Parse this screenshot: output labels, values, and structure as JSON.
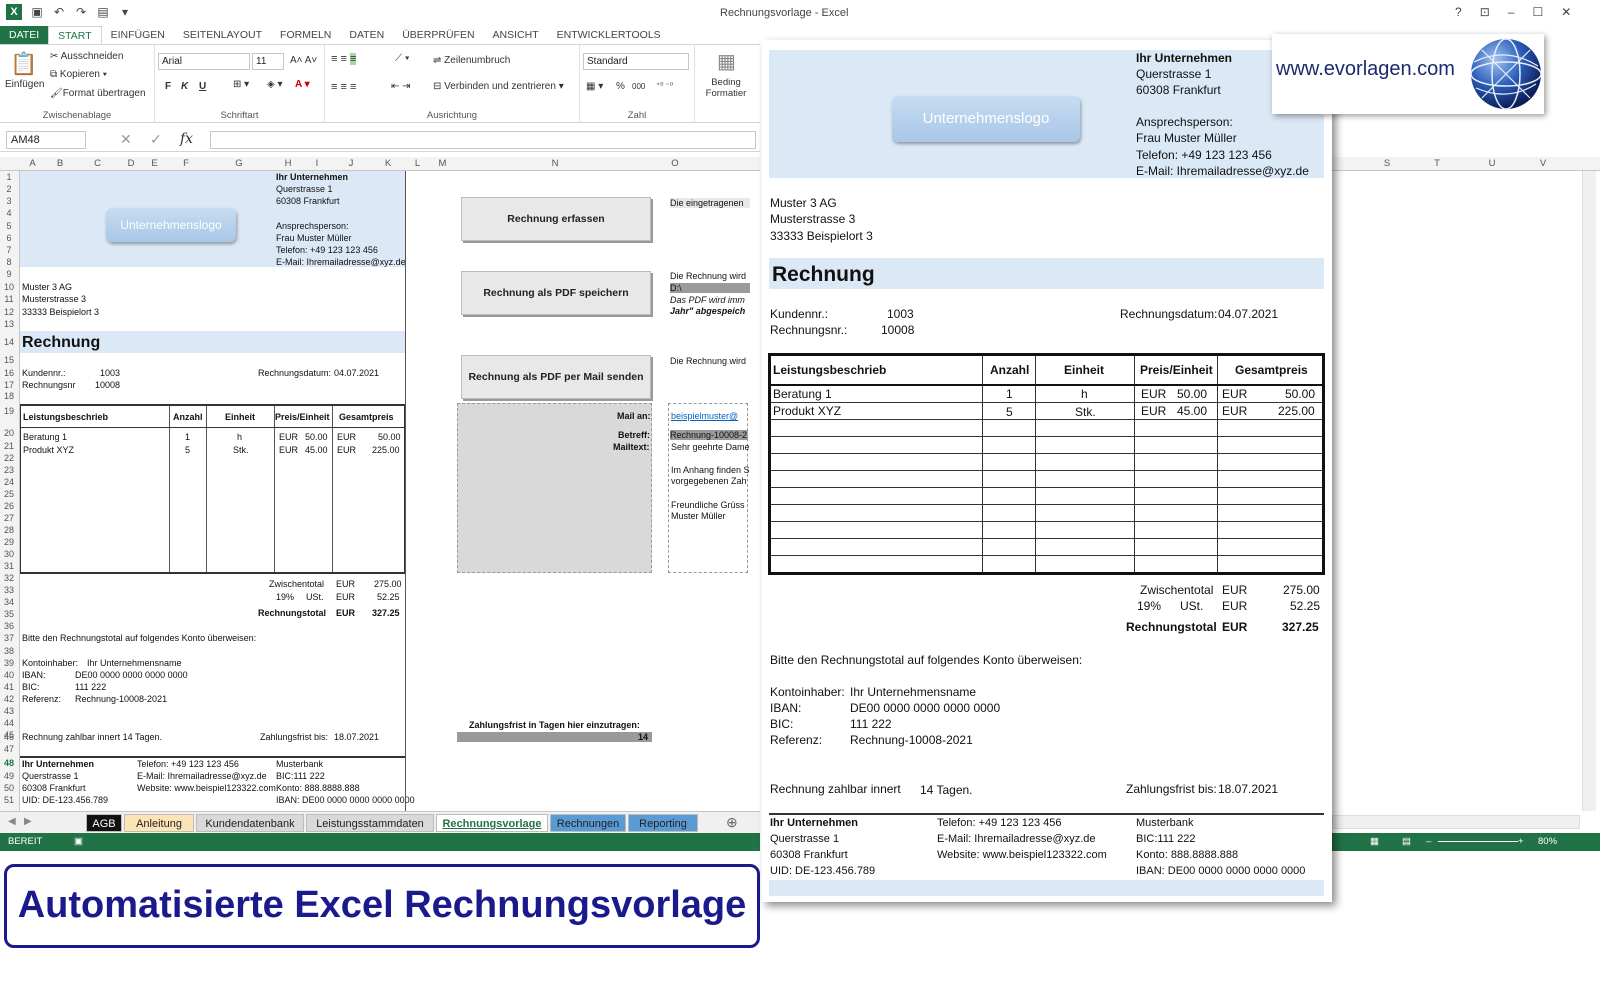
{
  "window": {
    "title": "Rechnungsvorlage - Excel",
    "help": "?"
  },
  "ribbon": {
    "tabs": [
      "DATEI",
      "START",
      "EINFÜGEN",
      "SEITENLAYOUT",
      "FORMELN",
      "DATEN",
      "ÜBERPRÜFEN",
      "ANSICHT",
      "ENTWICKLERTOOLS"
    ],
    "clipboard": {
      "paste": "Einfügen",
      "cut": "Ausschneiden",
      "copy": "Kopieren",
      "format": "Format übertragen",
      "label": "Zwischenablage"
    },
    "font": {
      "name": "Arial",
      "size": "11",
      "bold": "F",
      "italic": "K",
      "underline": "U",
      "label": "Schriftart"
    },
    "alignment": {
      "wrap": "Zeilenumbruch",
      "merge": "Verbinden und zentrieren",
      "label": "Ausrichtung"
    },
    "number": {
      "format": "Standard",
      "percent": "%",
      "thousands": "000",
      "label": "Zahl"
    },
    "styles": {
      "conditional": "Beding Formatier"
    }
  },
  "formula_bar": {
    "name_box": "AM48",
    "fx": "fx"
  },
  "columns": [
    "A",
    "B",
    "C",
    "D",
    "E",
    "F",
    "G",
    "H",
    "I",
    "J",
    "K",
    "L",
    "M",
    "N",
    "O"
  ],
  "right_columns": [
    "S",
    "T",
    "U",
    "V"
  ],
  "rows": [
    "1",
    "2",
    "3",
    "4",
    "5",
    "6",
    "7",
    "8",
    "9",
    "10",
    "11",
    "12",
    "13",
    "14",
    "15",
    "16",
    "17",
    "18",
    "19",
    "20",
    "21",
    "22",
    "23",
    "24",
    "25",
    "26",
    "27",
    "28",
    "29",
    "30",
    "31",
    "32",
    "33",
    "34",
    "35",
    "36",
    "37",
    "38",
    "39",
    "40",
    "41",
    "42",
    "43",
    "44",
    "45",
    "46",
    "47",
    "48",
    "49",
    "50",
    "51"
  ],
  "company": {
    "name": "Ihr Unternehmen",
    "street": "Querstrasse 1",
    "city": "60308 Frankfurt",
    "contact_label": "Ansprechsperson:",
    "contact": "Frau Muster Müller",
    "phone": "Telefon: +49 123 123 456",
    "email": "E-Mail: Ihremailadresse@xyz.de"
  },
  "logo": "Unternehmenslogo",
  "customer": {
    "name": "Muster 3 AG",
    "street": "Musterstrasse 3",
    "city": "33333  Beispielort 3"
  },
  "invoice": {
    "title": "Rechnung",
    "kunde_label": "Kundennr.:",
    "kunde": "1003",
    "nr_label": "Rechnungsnr.:",
    "nr_label_short": "Rechnungsnr",
    "nr": "10008",
    "date_label": "Rechnungsdatum:",
    "date": "04.07.2021"
  },
  "table": {
    "headers": [
      "Leistungsbeschrieb",
      "Anzahl",
      "Einheit",
      "Preis/Einheit",
      "Gesamtpreis"
    ],
    "rows": [
      {
        "desc": "Beratung 1",
        "qty": "1",
        "unit": "h",
        "cur": "EUR",
        "price": "50.00",
        "cur2": "EUR",
        "total": "50.00"
      },
      {
        "desc": "Produkt XYZ",
        "qty": "5",
        "unit": "Stk.",
        "cur": "EUR",
        "price": "45.00",
        "cur2": "EUR",
        "total": "225.00"
      }
    ]
  },
  "totals": {
    "sub_label": "Zwischentotal",
    "cur": "EUR",
    "sub": "275.00",
    "vat_pct": "19%",
    "vat_label": "USt.",
    "vat": "52.25",
    "total_label": "Rechnungstotal",
    "total": "327.25"
  },
  "payment": {
    "intro": "Bitte den Rechnungstotal auf folgendes Konto überweisen:",
    "holder_label": "Kontoinhaber:",
    "holder": "Ihr Unternehmensname",
    "iban_label": "IBAN:",
    "iban": "DE00 0000 0000 0000 0000",
    "bic_label": "BIC:",
    "bic": "111 222",
    "ref_label": "Referenz:",
    "ref": "Rechnung-10008-2021",
    "due_text": "Rechnung zahlbar innert",
    "days": "14",
    "days_suffix": "Tagen.",
    "deadline_label": "Zahlungsfrist bis:",
    "deadline": "18.07.2021"
  },
  "footer": {
    "c1": [
      "Ihr Unternehmen",
      "Querstrasse 1",
      "60308 Frankfurt",
      "UID: DE-123.456.789"
    ],
    "c2": [
      "Telefon: +49 123 123 456",
      "E-Mail: Ihremailadresse@xyz.de",
      "Website: www.beispiel123322.com"
    ],
    "c3": [
      "Musterbank",
      "BIC:111 222",
      "Konto: 888.8888.888",
      "IBAN: DE00 0000 0000 0000 0000"
    ]
  },
  "macros": {
    "btn1": "Rechnung erfassen",
    "btn2": "Rechnung als PDF speichern",
    "btn3": "Rechnung als PDF per Mail senden",
    "note1": "Die eingetragenen",
    "note2": "Die Rechnung wird",
    "path": "D:\\",
    "note3": "Das PDF wird imm",
    "note4": "Jahr\" abgespeich",
    "note5": "Die Rechnung wird",
    "mail_to_label": "Mail an:",
    "mail_to": "beispielmuster@",
    "subject_label": "Betreff:",
    "subject": "Rechnung-10008-2",
    "text_label": "Mailtext:",
    "mail_lines": [
      "Sehr geehrte Dame",
      "",
      "Im Anhang finden S",
      "vorgegebenen Zah",
      "",
      "Freundliche Grüss",
      "Muster Müller"
    ],
    "deadline_entry": "Zahlungsfrist in Tagen hier einzutragen:",
    "deadline_value": "14"
  },
  "sheet_tabs": [
    "AGB",
    "Anleitung",
    "Kundendatenbank",
    "Leistungsstammdaten",
    "Rechnungsvorlage",
    "Rechnungen",
    "Reporting"
  ],
  "status": {
    "ready": "BEREIT",
    "zoom": "80%"
  },
  "brand": {
    "url": "www.evorlagen.com"
  },
  "headline": "Automatisierte Excel Rechnungsvorlage",
  "colors": {
    "excel_green": "#217346",
    "headline_blue": "#1a1a8c",
    "band_blue": "#dbe8f6"
  }
}
